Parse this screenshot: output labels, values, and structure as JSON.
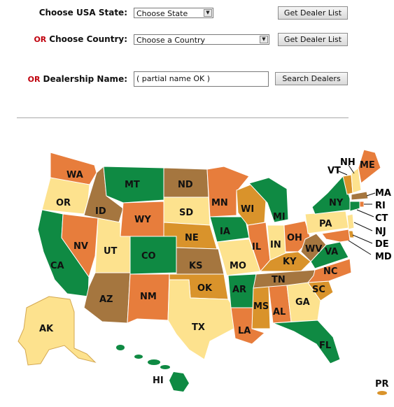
{
  "form": {
    "state_label": "Choose USA State:",
    "state_select": "Choose State",
    "state_button": "Get Dealer List",
    "or_text": "OR",
    "country_label": "Choose Country:",
    "country_select": "Choose a Country",
    "country_button": "Get Dealer List",
    "dealer_label": "Dealership Name:",
    "dealer_input": "( partial name OK )",
    "dealer_button": "Search Dealers"
  },
  "colors": {
    "green": "#0f8a43",
    "orange": "#e77d3c",
    "tan": "#fde28e",
    "brown": "#a5763f",
    "gold": "#d9932b"
  },
  "map": {
    "states": [
      {
        "label": "WA"
      },
      {
        "label": "OR"
      },
      {
        "label": "CA"
      },
      {
        "label": "ID"
      },
      {
        "label": "NV"
      },
      {
        "label": "MT"
      },
      {
        "label": "WY"
      },
      {
        "label": "UT"
      },
      {
        "label": "AZ"
      },
      {
        "label": "CO"
      },
      {
        "label": "NM"
      },
      {
        "label": "ND"
      },
      {
        "label": "SD"
      },
      {
        "label": "NE"
      },
      {
        "label": "KS"
      },
      {
        "label": "OK"
      },
      {
        "label": "TX"
      },
      {
        "label": "MN"
      },
      {
        "label": "IA"
      },
      {
        "label": "MO"
      },
      {
        "label": "AR"
      },
      {
        "label": "LA"
      },
      {
        "label": "WI"
      },
      {
        "label": "IL"
      },
      {
        "label": "MI"
      },
      {
        "label": "IN"
      },
      {
        "label": "OH"
      },
      {
        "label": "KY"
      },
      {
        "label": "TN"
      },
      {
        "label": "MS"
      },
      {
        "label": "AL"
      },
      {
        "label": "GA"
      },
      {
        "label": "FL"
      },
      {
        "label": "SC"
      },
      {
        "label": "NC"
      },
      {
        "label": "VA"
      },
      {
        "label": "WV"
      },
      {
        "label": "PA"
      },
      {
        "label": "NY"
      },
      {
        "label": "VT"
      },
      {
        "label": "NH"
      },
      {
        "label": "ME"
      },
      {
        "label": "MA"
      },
      {
        "label": "RI"
      },
      {
        "label": "CT"
      },
      {
        "label": "NJ"
      },
      {
        "label": "DE"
      },
      {
        "label": "MD"
      },
      {
        "label": "AK"
      },
      {
        "label": "HI"
      },
      {
        "label": "PR"
      }
    ]
  }
}
